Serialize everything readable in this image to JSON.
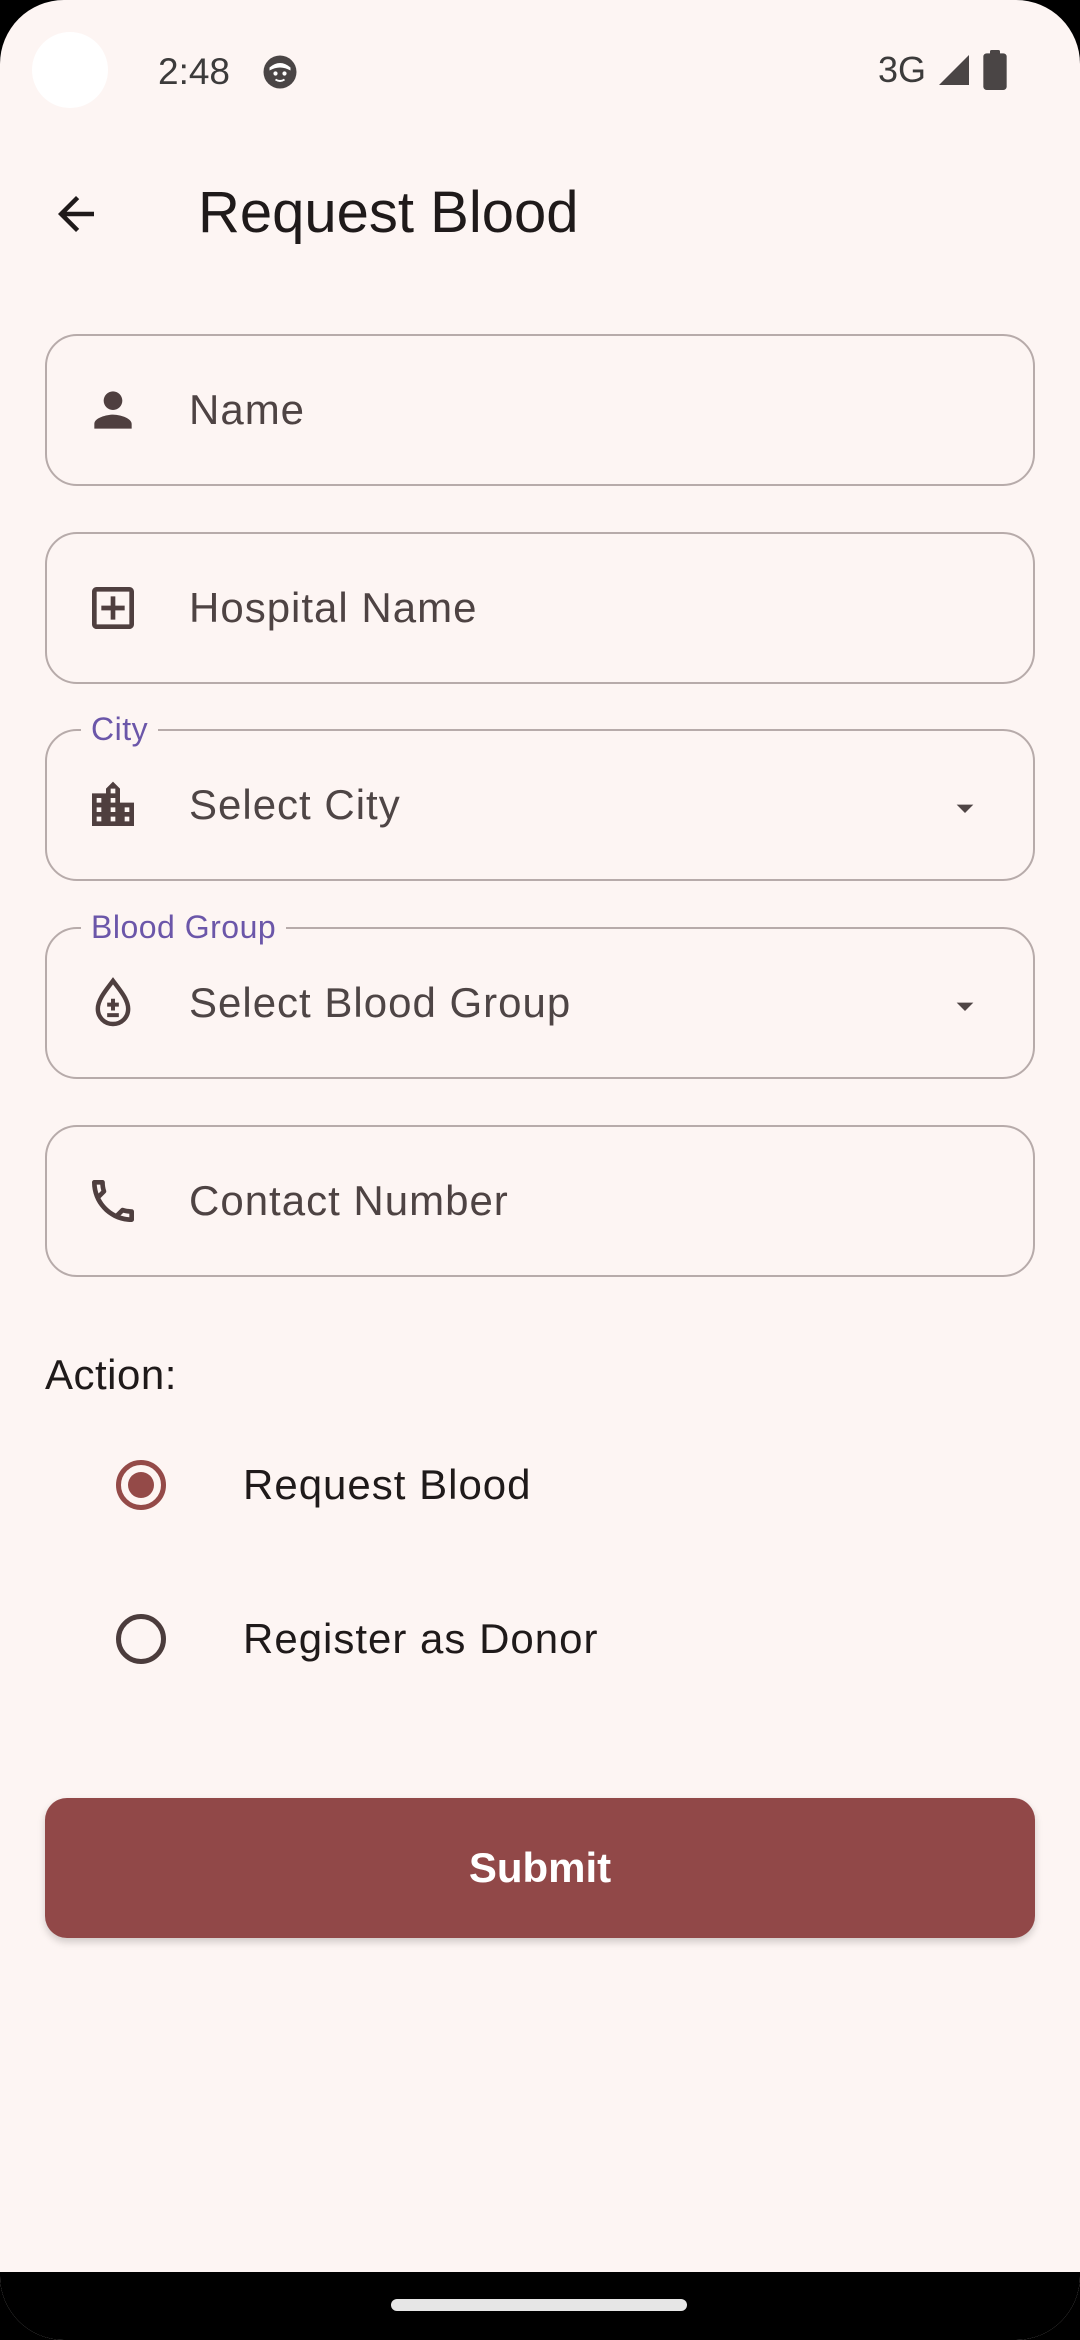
{
  "status_bar": {
    "time": "2:48",
    "network": "3G"
  },
  "app_bar": {
    "title": "Request Blood",
    "back_icon": "arrow-left-icon"
  },
  "form": {
    "name": {
      "placeholder": "Name",
      "value": "",
      "icon": "person-icon"
    },
    "hospital": {
      "placeholder": "Hospital Name",
      "value": "",
      "icon": "hospital-cross-icon"
    },
    "city": {
      "label": "City",
      "selected": "Select City",
      "icon": "city-buildings-icon"
    },
    "blood_group": {
      "label": "Blood Group",
      "selected": "Select Blood Group",
      "icon": "blood-drop-icon"
    },
    "contact": {
      "placeholder": "Contact Number",
      "value": "",
      "icon": "phone-icon"
    }
  },
  "action": {
    "label": "Action:",
    "options": [
      {
        "label": "Request Blood",
        "checked": true
      },
      {
        "label": "Register as Donor",
        "checked": false
      }
    ]
  },
  "submit": {
    "label": "Submit"
  },
  "colors": {
    "background": "#fdf5f3",
    "primary": "#914848",
    "label_accent": "#6b56a9",
    "outline": "#b7abaa"
  }
}
